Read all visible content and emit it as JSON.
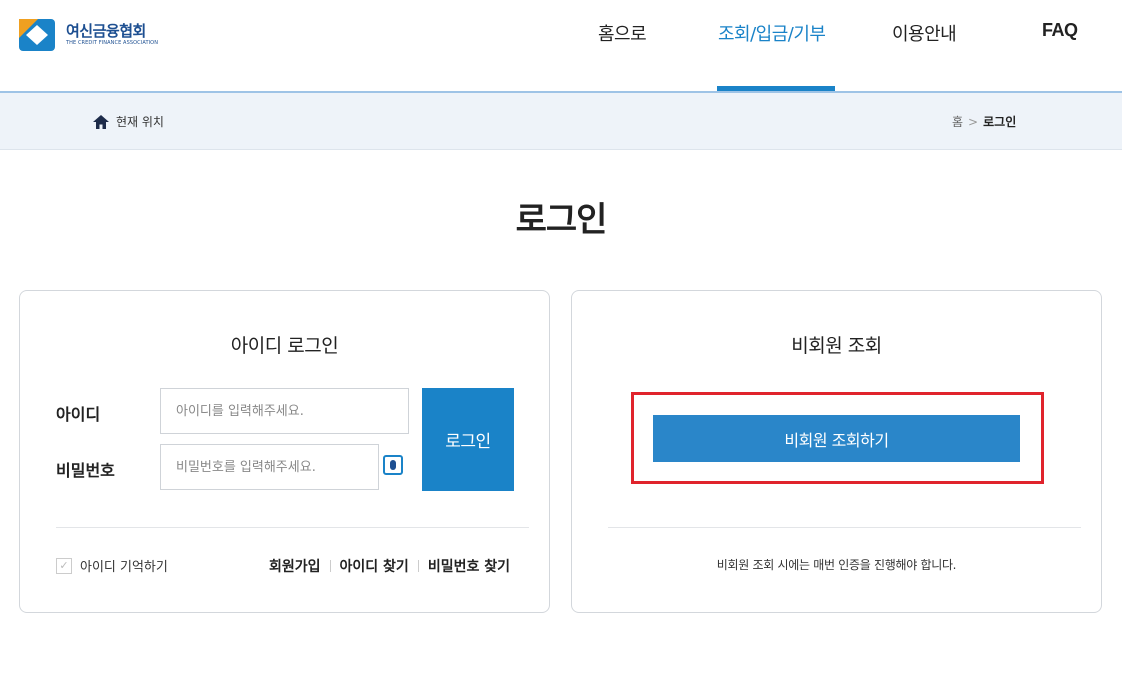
{
  "header": {
    "logo_title": "여신금융협회",
    "logo_subtitle": "THE CREDIT FINANCE ASSOCIATION",
    "nav": [
      {
        "label": "홈으로"
      },
      {
        "label": "조회/입금/기부",
        "active": true
      },
      {
        "label": "이용안내"
      },
      {
        "label": "FAQ"
      }
    ],
    "accent_color": "#1a83c8"
  },
  "breadcrumb": {
    "location_label": "현재 위치",
    "home": "홈",
    "separator": ">",
    "current": "로그인"
  },
  "page": {
    "title": "로그인"
  },
  "login_panel": {
    "title": "아이디 로그인",
    "id_label": "아이디",
    "id_placeholder": "아이디를 입력해주세요.",
    "pw_label": "비밀번호",
    "pw_placeholder": "비밀번호를 입력해주세요.",
    "login_button": "로그인",
    "remember_label": "아이디 기억하기",
    "remember_checked": true,
    "links": [
      "회원가입",
      "아이디 찾기",
      "비밀번호 찾기"
    ]
  },
  "guest_panel": {
    "title": "비회원 조회",
    "button": "비회원 조회하기",
    "note": "비회원 조회 시에는 매번 인증을 진행해야 합니다.",
    "highlight_color": "#e0232c"
  }
}
